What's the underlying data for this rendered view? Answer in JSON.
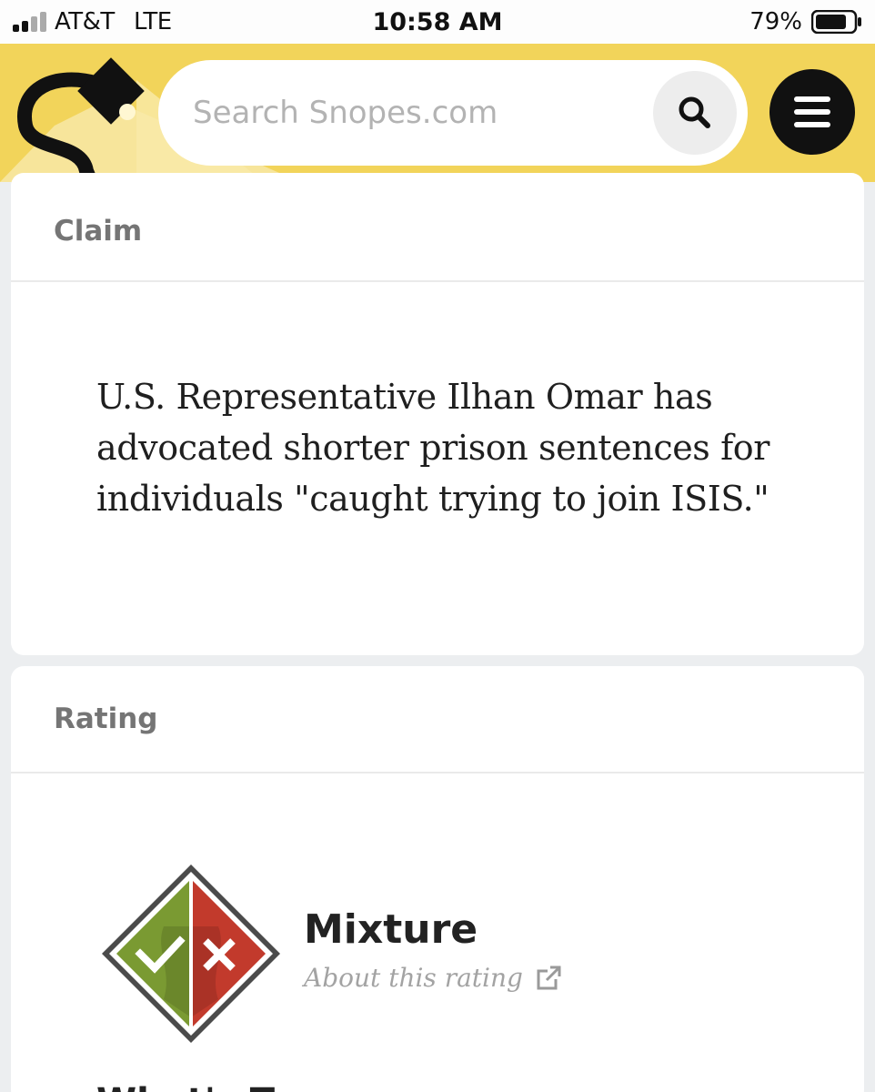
{
  "status_bar": {
    "carrier": "AT&T",
    "network": "LTE",
    "time": "10:58 AM",
    "battery_percent": "79%",
    "battery_level": 0.79
  },
  "header": {
    "logo_icon": "snopes-spotlight-logo",
    "search_placeholder": "Search Snopes.com",
    "search_icon": "search-icon",
    "menu_icon": "hamburger-menu-icon",
    "brand_color": "#f2d45a"
  },
  "claim": {
    "title": "Claim",
    "text": "U.S. Representative Ilhan Omar has advocated shorter prison sentences for individuals \"caught trying to join ISIS.\""
  },
  "rating": {
    "title": "Rating",
    "badge_icon": "mixture-rating-icon",
    "label": "Mixture",
    "about_link": "About this rating",
    "external_icon": "external-link-icon",
    "colors": {
      "true": "#7a9a32",
      "false": "#c23a2c"
    }
  },
  "next_section": {
    "heading_partial": "What's T"
  }
}
